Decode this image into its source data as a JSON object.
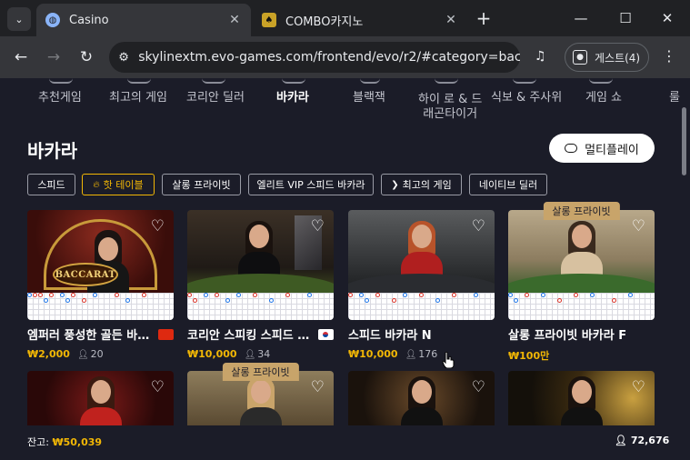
{
  "browser": {
    "tabs": [
      {
        "title": "Casino",
        "favicon": "globe-icon"
      },
      {
        "title": "COMBO카지노",
        "favicon": "combo-icon"
      }
    ],
    "url": "skylinextm.evo-games.com/frontend/evo/r2/#category=bacc...",
    "profile_label": "게스트(4)"
  },
  "categories": [
    {
      "label": "추천게임"
    },
    {
      "label": "최고의 게임"
    },
    {
      "label": "코리안 딜러"
    },
    {
      "label": "바카라",
      "active": true
    },
    {
      "label": "블랙잭"
    },
    {
      "label": "하이 로 & 드\n래곤타이거"
    },
    {
      "label": "식보 & 주사위"
    },
    {
      "label": "게임 쇼"
    },
    {
      "label": "룰"
    }
  ],
  "section": {
    "title": "바카라",
    "multiplay_label": "멀티플레이"
  },
  "filters": [
    {
      "label": "스피드"
    },
    {
      "label": "핫 테이블",
      "active": true,
      "icon": "flame-icon"
    },
    {
      "label": "살롱 프라이빗"
    },
    {
      "label": "엘리트 VIP 스피드 바카라"
    },
    {
      "label": "최고의 게임",
      "icon": "chevron-icon"
    },
    {
      "label": "네이티브 딜러"
    }
  ],
  "games": [
    {
      "name": "엠퍼러 풍성한 골든 바카...",
      "flag": "cn",
      "bet": "₩2,000",
      "players": "20",
      "logo_text": "BACCARAT"
    },
    {
      "name": "코리안 스피킹 스피드 바...",
      "flag": "kr",
      "bet": "₩10,000",
      "players": "34"
    },
    {
      "name": "스피드 바카라 N",
      "bet": "₩10,000",
      "players": "176"
    },
    {
      "name": "살롱 프라이빗 바카라 F",
      "bet": "₩100만",
      "badge": "살롱 프라이빗"
    }
  ],
  "games_row2": [
    {},
    {
      "badge": "살롱 프라이빗"
    },
    {},
    {}
  ],
  "footer": {
    "balance_label": "잔고: ",
    "balance_value": "₩50,039",
    "total_players": "72,676"
  },
  "colors": {
    "accent": "#f2b705",
    "background": "#1b1c28",
    "salon_badge": "#c8a46a"
  }
}
